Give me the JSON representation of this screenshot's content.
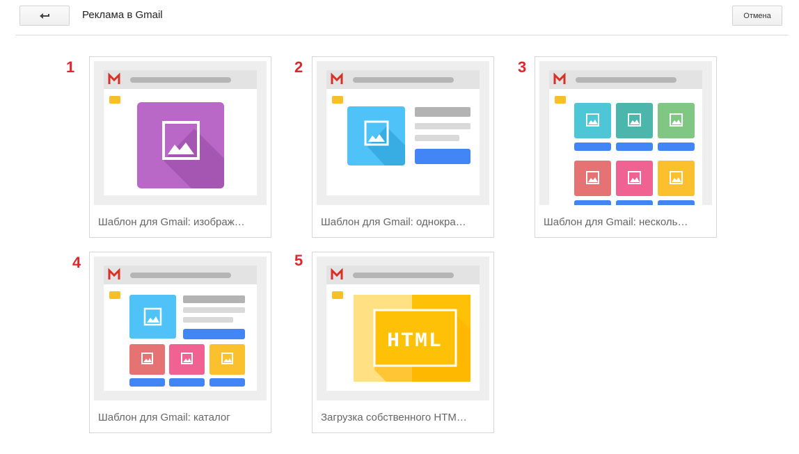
{
  "header": {
    "title": "Реклама в Gmail",
    "cancel_label": "Отмена",
    "back_icon": "back-arrow-icon"
  },
  "templates": [
    {
      "number": "1",
      "label": "Шаблон для Gmail: изображ…",
      "kind": "single-image"
    },
    {
      "number": "2",
      "label": "Шаблон для Gmail: однокра…",
      "kind": "single-promotion"
    },
    {
      "number": "3",
      "label": "Шаблон для Gmail: несколь…",
      "kind": "multi-product"
    },
    {
      "number": "4",
      "label": "Шаблон для Gmail: каталог",
      "kind": "catalog"
    },
    {
      "number": "5",
      "label": "Загрузка собственного HTM…",
      "kind": "custom-html",
      "badge": "HTML"
    }
  ],
  "colors": {
    "number": "#e0262d",
    "gmail_red": "#d93025",
    "purple": "#ba68c8",
    "blue_image": "#4fc3f7",
    "button_blue": "#4285f4",
    "yellow": "#f6c026",
    "html_yellow": "#ffc107"
  }
}
